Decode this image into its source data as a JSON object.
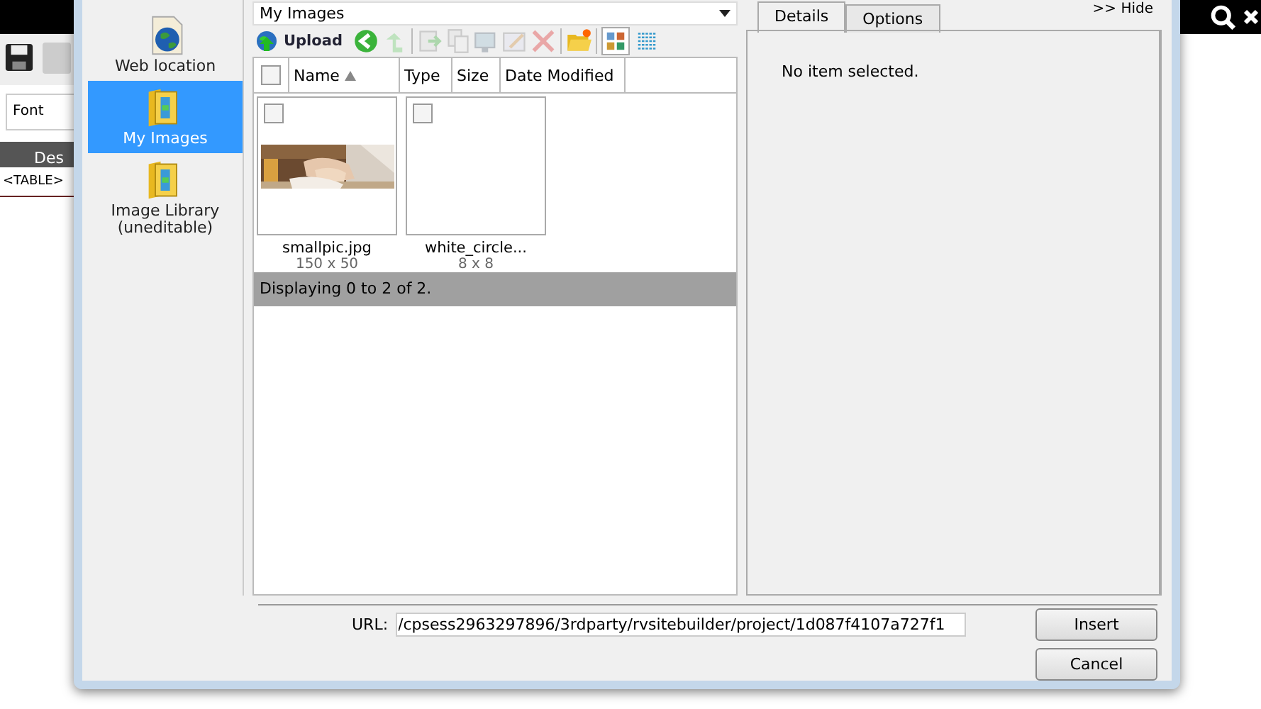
{
  "background_app": {
    "font_field": "Font",
    "tab": "Des",
    "breadcrumb": "<TABLE>"
  },
  "sidebar": {
    "items": [
      {
        "label": "Web location",
        "kind": "globe",
        "selected": false
      },
      {
        "label": "My Images",
        "kind": "folder",
        "selected": true
      },
      {
        "label": "Image Library (uneditable)",
        "kind": "folder",
        "selected": false
      }
    ]
  },
  "folder_select": {
    "value": "My Images"
  },
  "toolbar": {
    "upload": "Upload",
    "tools": [
      {
        "kind": "back",
        "disabled": false
      },
      {
        "kind": "up",
        "disabled": true
      },
      {
        "kind": "copy",
        "disabled": true
      },
      {
        "kind": "duplicate",
        "disabled": true
      },
      {
        "kind": "resize",
        "disabled": true
      },
      {
        "kind": "edit",
        "disabled": true
      },
      {
        "kind": "delete",
        "disabled": true
      },
      {
        "kind": "new-folder",
        "disabled": false
      }
    ],
    "views": [
      {
        "kind": "thumbnails",
        "selected": true
      },
      {
        "kind": "list",
        "selected": false
      }
    ]
  },
  "select_all": {
    "checked": false
  },
  "columns": [
    {
      "label": "Name",
      "sorted": true
    },
    {
      "label": "Type",
      "sorted": false
    },
    {
      "label": "Size",
      "sorted": false
    },
    {
      "label": "Date Modified",
      "sorted": false
    }
  ],
  "files": [
    {
      "name": "smallpic.jpg",
      "dimensions": "150 x 50",
      "checked": false,
      "kind": "picture"
    },
    {
      "name": "white_circle...",
      "dimensions": "8 x 8",
      "checked": false,
      "kind": "blank"
    }
  ],
  "status": "Displaying 0 to 2 of 2.",
  "details": {
    "tabs": [
      {
        "label": "Details",
        "selected": true
      },
      {
        "label": "Options",
        "selected": false
      }
    ],
    "hide": ">> Hide",
    "message": "No item selected."
  },
  "url": {
    "label": "URL:",
    "value": "/cpsess2963297896/3rdparty/rvsitebuilder/project/1d087f4107a727f1"
  },
  "buttons": [
    "Insert",
    "Cancel"
  ]
}
